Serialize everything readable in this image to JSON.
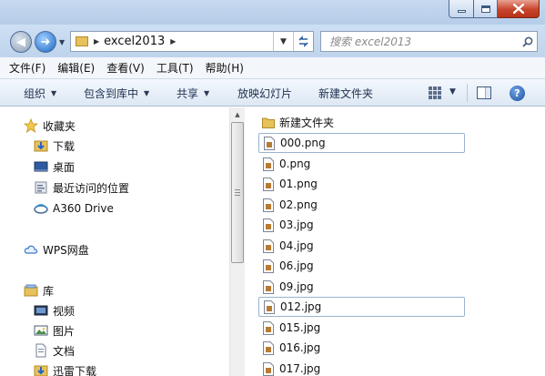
{
  "address": {
    "path": "excel2013"
  },
  "search": {
    "placeholder": "搜索 excel2013"
  },
  "menu": [
    "文件(F)",
    "编辑(E)",
    "查看(V)",
    "工具(T)",
    "帮助(H)"
  ],
  "toolbar": {
    "organize": "组织",
    "include_in_library": "包含到库中",
    "share": "共享",
    "slideshow": "放映幻灯片",
    "new_folder": "新建文件夹"
  },
  "nav": {
    "favorites": "收藏夹",
    "downloads": "下载",
    "desktop": "桌面",
    "recent": "最近访问的位置",
    "a360": "A360 Drive",
    "wps": "WPS网盘",
    "library": "库",
    "videos": "视频",
    "pictures": "图片",
    "documents": "文档",
    "xunlei": "迅雷下载"
  },
  "files": [
    {
      "name": "新建文件夹",
      "type": "folder"
    },
    {
      "name": "000.png",
      "type": "image",
      "highlight": true
    },
    {
      "name": "0.png",
      "type": "image"
    },
    {
      "name": "01.png",
      "type": "image"
    },
    {
      "name": "02.png",
      "type": "image"
    },
    {
      "name": "03.jpg",
      "type": "image"
    },
    {
      "name": "04.jpg",
      "type": "image"
    },
    {
      "name": "06.jpg",
      "type": "image"
    },
    {
      "name": "09.jpg",
      "type": "image"
    },
    {
      "name": "012.jpg",
      "type": "image",
      "highlight": true
    },
    {
      "name": "015.jpg",
      "type": "image"
    },
    {
      "name": "016.jpg",
      "type": "image"
    },
    {
      "name": "017.jpg",
      "type": "image"
    }
  ],
  "colors": {
    "accent": "#1a63c4",
    "toolbar_text": "#1e3050",
    "folder": "#e6c15c"
  }
}
